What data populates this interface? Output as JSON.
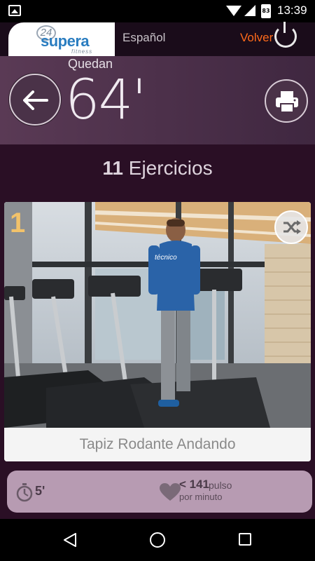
{
  "status_bar": {
    "time": "13:39",
    "battery_level": "83",
    "icons": [
      "image-notification-icon",
      "wifi-icon",
      "signal-icon",
      "battery-icon"
    ]
  },
  "header": {
    "logo": {
      "mark": "24",
      "brand": "supera",
      "sub": "fitness"
    },
    "language": "Español",
    "back_label": "Volver",
    "power_icon": "power-icon"
  },
  "timer": {
    "label": "Quedan",
    "value": "64'"
  },
  "summary": {
    "count": "11",
    "label": "Ejercicios"
  },
  "exercise": {
    "number": "1",
    "title": "Tapiz Rodante Andando",
    "duration": "5'",
    "pulse_value": "< 141",
    "pulse_unit": "pulso",
    "pulse_sub": "por minuto"
  },
  "colors": {
    "accent": "#ff6a1a",
    "number": "#f2c26a",
    "header_bg": "#1a0c1a",
    "timer_bg": "#4a3248",
    "content_bg": "#2a0f25",
    "info_bar": "#b79bb2"
  }
}
